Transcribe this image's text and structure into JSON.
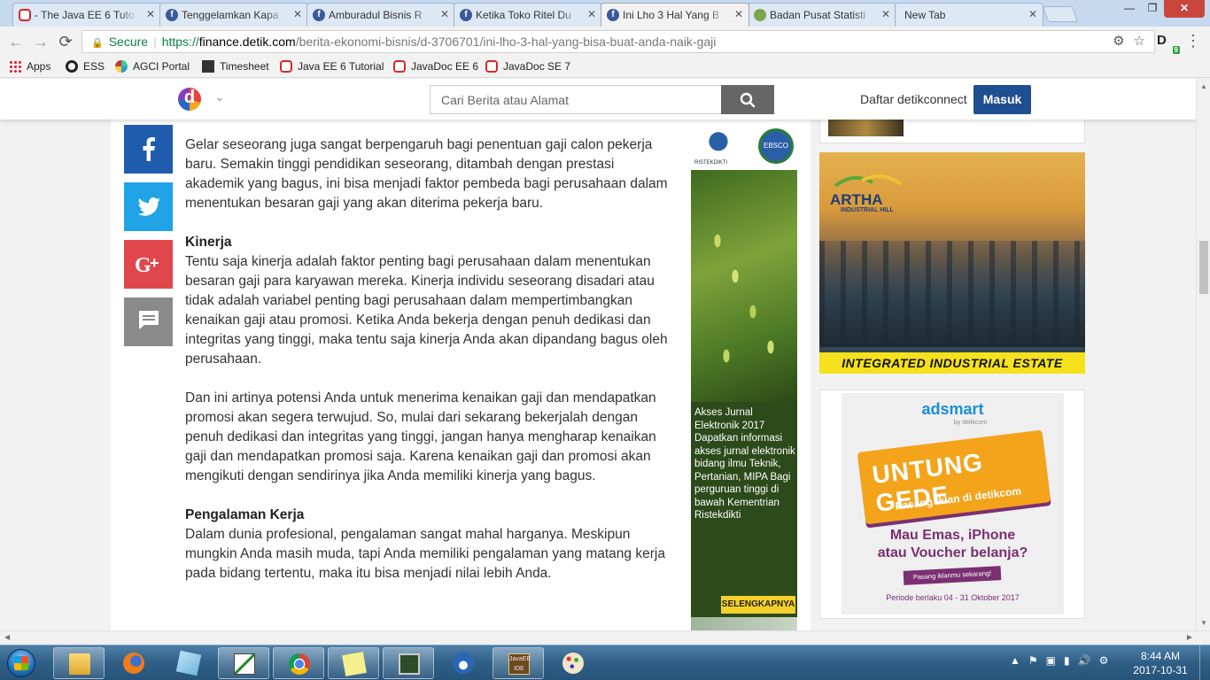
{
  "browser": {
    "tabs": [
      {
        "title": "- The Java EE 6 Tuto",
        "icon": "oracle-icon"
      },
      {
        "title": "Tenggelamkan Kapa",
        "icon": "facebook-icon"
      },
      {
        "title": "Amburadul Bisnis R",
        "icon": "facebook-icon"
      },
      {
        "title": "Ketika Toko Ritel Du",
        "icon": "facebook-icon"
      },
      {
        "title": "Ini Lho 3 Hal Yang B",
        "icon": "facebook-icon",
        "active": true
      },
      {
        "title": "Badan Pusat Statisti",
        "icon": "bps-icon"
      },
      {
        "title": "New Tab",
        "icon": "none"
      }
    ],
    "tab_close": "✕",
    "window_controls": {
      "minimize": "—",
      "maximize": "❐",
      "close": "✕"
    },
    "nav": {
      "back": "←",
      "forward": "→",
      "reload": "⟳"
    },
    "address": {
      "secure_label": "Secure",
      "protocol": "https://",
      "host": "finance.detik.com",
      "path": "/berita-ekonomi-bisnis/d-3706701/ini-lho-3-hal-yang-bisa-buat-anda-naik-gaji"
    },
    "extension_badge": "9",
    "bookmarks": [
      "Apps",
      "ESS",
      "AGCI Portal",
      "Timesheet",
      "Java EE 6 Tutorial",
      "JavaDoc EE 6",
      "JavaDoc SE 7"
    ]
  },
  "site": {
    "logo_letter": "d",
    "search_placeholder": "Cari Berita atau Alamat",
    "register_label": "Daftar detikconnect",
    "login_label": "Masuk"
  },
  "article": {
    "p1": "Gelar seseorang juga sangat berpengaruh bagi penentuan gaji calon pekerja baru. Semakin tinggi pendidikan seseorang, ditambah dengan prestasi akademik yang bagus, ini bisa menjadi faktor pembeda bagi perusahaan dalam menentukan besaran gaji yang akan diterima pekerja baru.",
    "h2": "Kinerja",
    "p2": "Tentu saja kinerja adalah faktor penting bagi perusahaan dalam menentukan besaran gaji para karyawan mereka. Kinerja individu seseorang disadari atau tidak adalah variabel penting bagi perusahaan dalam mempertimbangkan kenaikan gaji atau promosi. Ketika Anda bekerja dengan penuh dedikasi dan integritas yang tinggi, maka tentu saja kinerja Anda akan dipandang bagus oleh perusahaan.",
    "p3": "Dan ini artinya potensi Anda untuk menerima kenaikan gaji dan mendapatkan promosi akan segera terwujud. So, mulai dari sekarang bekerjalah dengan penuh dedikasi dan integritas yang tinggi, jangan hanya mengharap kenaikan gaji dan mendapatkan promosi saja. Karena kenaikan gaji dan promosi akan mengikuti dengan sendirinya jika Anda memiliki kinerja yang bagus.",
    "h3": "Pengalaman Kerja",
    "p4": "Dalam dunia profesional, pengalaman sangat mahal harganya. Meskipun mungkin Anda masih muda, tapi Anda memiliki pengalaman yang matang kerja pada bidang tertentu, maka itu bisa menjadi nilai lebih Anda."
  },
  "ads": {
    "ristek_label": "RISTEKDIKTI",
    "ebsco_label": "EBSCO",
    "center_text": "Akses Jurnal Elektronik 2017 Dapatkan informasi akses jurnal elektronik bidang ilmu Teknik, Pertanian, MIPA Bagi perguruan tinggi di bawah Kementrian Ristekdikti",
    "center_cta": "SELENGKAPNYA",
    "artha_name": "ARTHA",
    "artha_sub": "INDUSTRIAL HILL",
    "artha_banner": "INTEGRATED INDUSTRIAL ESTATE",
    "adsmart_brand": "adsmart",
    "adsmart_by": "by detikcom",
    "adsmart_headline": "UNTUNG GEDE",
    "adsmart_sub": "Pasang Iklan di detikcom",
    "adsmart_q1": "Mau Emas, iPhone",
    "adsmart_q2": "atau Voucher belanja?",
    "adsmart_pill": "Pasang iklanmu sekarang!",
    "adsmart_period": "Periode berlaku 04 - 31 Oktober 2017"
  },
  "taskbar": {
    "time": "8:44 AM",
    "date": "2017-10-31"
  }
}
